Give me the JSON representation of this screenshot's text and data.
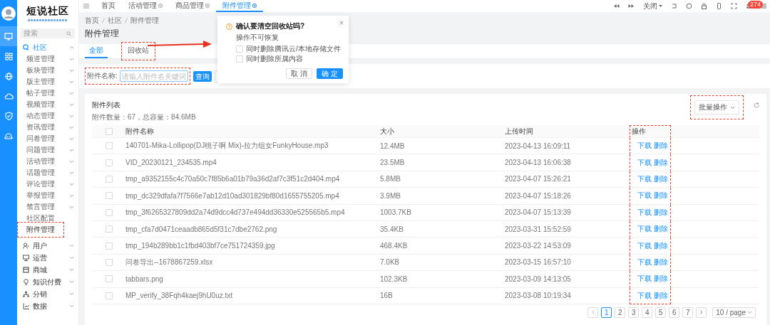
{
  "rail": [
    {
      "kind": "monitor",
      "selected": true
    },
    {
      "kind": "grid",
      "selected": false
    },
    {
      "kind": "globe",
      "selected": false
    },
    {
      "kind": "cloud",
      "selected": false
    },
    {
      "kind": "shield",
      "selected": false
    },
    {
      "kind": "robot",
      "selected": false
    }
  ],
  "sidebar": {
    "logo": "短说社区",
    "search": {
      "placeholder": "搜索"
    },
    "menu": [
      {
        "label": "社区",
        "kind": "community",
        "expanded": true,
        "children": [
          {
            "label": "频道管理",
            "has_children": true,
            "selected": false,
            "highlighted": false
          },
          {
            "label": "板块管理",
            "has_children": true,
            "selected": false,
            "highlighted": false
          },
          {
            "label": "版主管理",
            "has_children": true,
            "selected": false,
            "highlighted": false
          },
          {
            "label": "帖子管理",
            "has_children": true,
            "selected": false,
            "highlighted": false
          },
          {
            "label": "视频管理",
            "has_children": true,
            "selected": false,
            "highlighted": false
          },
          {
            "label": "动态管理",
            "has_children": true,
            "selected": false,
            "highlighted": false
          },
          {
            "label": "资讯管理",
            "has_children": true,
            "selected": false,
            "highlighted": false
          },
          {
            "label": "问卷管理",
            "has_children": true,
            "selected": false,
            "highlighted": false
          },
          {
            "label": "问题管理",
            "has_children": true,
            "selected": false,
            "highlighted": false
          },
          {
            "label": "活动管理",
            "has_children": true,
            "selected": false,
            "highlighted": false
          },
          {
            "label": "话题管理",
            "has_children": true,
            "selected": false,
            "highlighted": false
          },
          {
            "label": "评论管理",
            "has_children": true,
            "selected": false,
            "highlighted": false
          },
          {
            "label": "举报管理",
            "has_children": true,
            "selected": false,
            "highlighted": false
          },
          {
            "label": "禁言管理",
            "has_children": true,
            "selected": false,
            "highlighted": false
          },
          {
            "label": "社区配置",
            "has_children": false,
            "selected": false,
            "highlighted": false
          },
          {
            "label": "附件管理",
            "has_children": false,
            "selected": true,
            "highlighted": true
          }
        ]
      },
      {
        "label": "用户",
        "kind": "user",
        "expanded": false
      },
      {
        "label": "运营",
        "kind": "operation",
        "expanded": false
      },
      {
        "label": "商城",
        "kind": "shop",
        "expanded": false
      },
      {
        "label": "知识付费",
        "kind": "bulb",
        "expanded": false
      },
      {
        "label": "分销",
        "kind": "network",
        "expanded": false
      },
      {
        "label": "数据",
        "kind": "chart",
        "expanded": false
      }
    ]
  },
  "topbar": {
    "tabs": [
      {
        "label": "首页",
        "closable": false,
        "selected": false
      },
      {
        "label": "活动管理",
        "closable": true,
        "selected": false
      },
      {
        "label": "商品管理",
        "closable": true,
        "selected": false
      },
      {
        "label": "附件管理",
        "closable": true,
        "selected": true
      }
    ],
    "close_menu": "关闭",
    "notifications": "274"
  },
  "breadcrumb": [
    "首页",
    "社区",
    "附件管理"
  ],
  "title": "附件管理",
  "tabs": [
    {
      "label": "全部",
      "selected": true,
      "highlighted": false
    },
    {
      "label": "回收站",
      "selected": false,
      "highlighted": true
    }
  ],
  "filter": {
    "label": "附件名称:",
    "placeholder": "请输入附件名关键词",
    "highlighted": true,
    "search_button": "查询"
  },
  "dialog": {
    "title": "确认要清空回收站吗?",
    "subtitle": "操作不可恢复",
    "options": [
      {
        "label": "同时删除腾讯云/本地存储文件",
        "checked": false
      },
      {
        "label": "同时删除所属内容",
        "checked": false
      }
    ],
    "cancel": "取 消",
    "confirm": "确 定"
  },
  "list": {
    "title": "附件列表",
    "summary": "附件数量：67，总容量：84.6MB",
    "batch": {
      "label": "批量操作",
      "highlighted": true
    },
    "columns": [
      {
        "label": "附件名称",
        "highlighted": false
      },
      {
        "label": "大小",
        "highlighted": false
      },
      {
        "label": "上传时间",
        "highlighted": false
      },
      {
        "label": "操作",
        "highlighted": true
      }
    ],
    "header_checked": false,
    "rows": [
      {
        "checked": false,
        "name": "140701-Mika-Lollipop(DJ桃子啊 Mix)-拉力组女FunkyHouse.mp3",
        "size": "12.4MB",
        "uploaded": "2023-04-13 16:09:11",
        "actions": [
          "下载",
          "删除"
        ]
      },
      {
        "checked": false,
        "name": "VID_20230121_234535.mp4",
        "size": "23.5MB",
        "uploaded": "2023-04-13 16:06:38",
        "actions": [
          "下载",
          "删除"
        ]
      },
      {
        "checked": false,
        "name": "tmp_a9352155c4c70a50c7f85b6a01b79a36d2af7c3f51c2d404.mp4",
        "size": "5.8MB",
        "uploaded": "2023-04-07 15:26:21",
        "actions": [
          "下载",
          "删除"
        ]
      },
      {
        "checked": false,
        "name": "tmp_dc329dfafa7f7566e7ab12d10ad301829bf80d1655755205.mp4",
        "size": "3.9MB",
        "uploaded": "2023-04-07 15:18:26",
        "actions": [
          "下载",
          "删除"
        ]
      },
      {
        "checked": false,
        "name": "tmp_3f6265327809dd2a74d9dcc4d737e494dd36330e525565b5.mp4",
        "size": "1003.7KB",
        "uploaded": "2023-04-07 15:13:39",
        "actions": [
          "下载",
          "删除"
        ]
      },
      {
        "checked": false,
        "name": "tmp_cfa7d0471ceaadb865d5f31c7dbe2762.png",
        "size": "35.4KB",
        "uploaded": "2023-03-31 15:52:59",
        "actions": [
          "下载",
          "删除"
        ]
      },
      {
        "checked": false,
        "name": "tmp_194b289bb1c1fbd403bf7ce751724359.jpg",
        "size": "468.4KB",
        "uploaded": "2023-03-22 14:53:09",
        "actions": [
          "下载",
          "删除"
        ]
      },
      {
        "checked": false,
        "name": "问卷导出--1678867259.xlsx",
        "size": "7.0KB",
        "uploaded": "2023-03-15 16:57:10",
        "actions": [
          "下载",
          "删除"
        ]
      },
      {
        "checked": false,
        "name": "tabbars.png",
        "size": "102.3KB",
        "uploaded": "2023-03-09 14:13:05",
        "actions": [
          "下载",
          "删除"
        ]
      },
      {
        "checked": false,
        "name": "MP_verify_38Fqh4kaej9hU0uz.txt",
        "size": "16B",
        "uploaded": "2023-03-08 10:19:34",
        "actions": [
          "下载",
          "删除"
        ]
      }
    ]
  },
  "pagination": {
    "pages": [
      {
        "label": "1",
        "selected": true
      },
      {
        "label": "2",
        "selected": false
      },
      {
        "label": "3",
        "selected": false
      },
      {
        "label": "4",
        "selected": false
      },
      {
        "label": "5",
        "selected": false
      },
      {
        "label": "6",
        "selected": false
      },
      {
        "label": "7",
        "selected": false
      }
    ],
    "page_size": "10 / page"
  }
}
